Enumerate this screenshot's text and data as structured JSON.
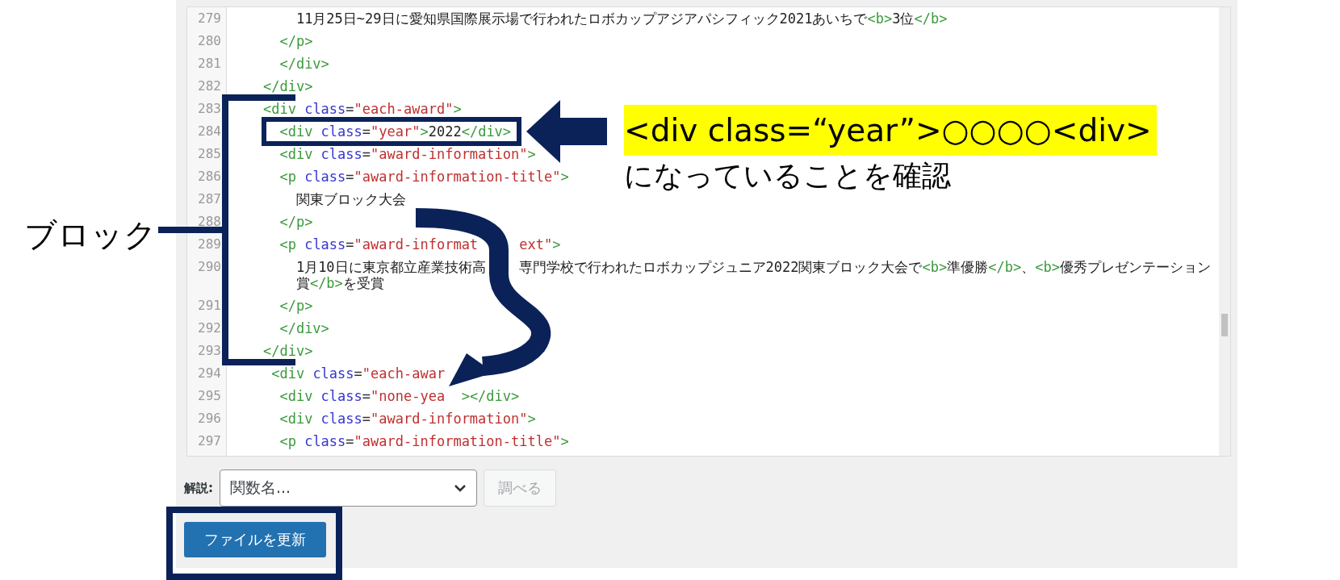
{
  "editor": {
    "lines": [
      {
        "number": "279",
        "tokens": [
          {
            "kind": "text",
            "text": "        11月25日~29日に愛知県国際展示場で行われたロボカップアジアパシフィック2021あいちで"
          },
          {
            "kind": "tag",
            "text": "<b>"
          },
          {
            "kind": "text",
            "text": "3位"
          },
          {
            "kind": "tag",
            "text": "</b>"
          }
        ]
      },
      {
        "number": "280",
        "tokens": [
          {
            "kind": "tag",
            "text": "      </p>"
          }
        ]
      },
      {
        "number": "281",
        "tokens": [
          {
            "kind": "tag",
            "text": "      </div>"
          }
        ]
      },
      {
        "number": "282",
        "tokens": [
          {
            "kind": "tag",
            "text": "    </div>"
          }
        ]
      },
      {
        "number": "283",
        "tokens": [
          {
            "kind": "tag",
            "text": "    <div"
          },
          {
            "kind": "attr",
            "text": " class"
          },
          {
            "kind": "op",
            "text": "="
          },
          {
            "kind": "str",
            "text": "\"each-award\""
          },
          {
            "kind": "tag",
            "text": ">"
          }
        ]
      },
      {
        "number": "284",
        "tokens": [
          {
            "kind": "tag",
            "text": "      <div"
          },
          {
            "kind": "attr",
            "text": " class"
          },
          {
            "kind": "op",
            "text": "="
          },
          {
            "kind": "str",
            "text": "\"year\""
          },
          {
            "kind": "tag",
            "text": ">"
          },
          {
            "kind": "text",
            "text": "2022"
          },
          {
            "kind": "tag",
            "text": "</div>"
          }
        ]
      },
      {
        "number": "285",
        "tokens": [
          {
            "kind": "tag",
            "text": "      <div"
          },
          {
            "kind": "attr",
            "text": " class"
          },
          {
            "kind": "op",
            "text": "="
          },
          {
            "kind": "str",
            "text": "\"award-information\""
          },
          {
            "kind": "tag",
            "text": ">"
          }
        ]
      },
      {
        "number": "286",
        "tokens": [
          {
            "kind": "tag",
            "text": "      <p"
          },
          {
            "kind": "attr",
            "text": " class"
          },
          {
            "kind": "op",
            "text": "="
          },
          {
            "kind": "str",
            "text": "\"award-information-title\""
          },
          {
            "kind": "tag",
            "text": ">"
          }
        ]
      },
      {
        "number": "287",
        "tokens": [
          {
            "kind": "text",
            "text": "        関東ブロック大会"
          }
        ]
      },
      {
        "number": "288",
        "tokens": [
          {
            "kind": "tag",
            "text": "      </p>"
          }
        ]
      },
      {
        "number": "289",
        "tokens": [
          {
            "kind": "tag",
            "text": "      <p"
          },
          {
            "kind": "attr",
            "text": " class"
          },
          {
            "kind": "op",
            "text": "="
          },
          {
            "kind": "str",
            "text": "\"award-informat     ext\""
          },
          {
            "kind": "tag",
            "text": ">"
          }
        ]
      },
      {
        "number": "290",
        "tokens": [
          {
            "kind": "text",
            "text": "        1月10日に東京都立産業技術高    専門学校で行われたロボカップジュニア2022関東ブロック大会で"
          },
          {
            "kind": "tag",
            "text": "<b>"
          },
          {
            "kind": "text",
            "text": "準優勝"
          },
          {
            "kind": "tag",
            "text": "</b>"
          },
          {
            "kind": "text",
            "text": "、"
          },
          {
            "kind": "tag",
            "text": "<b>"
          },
          {
            "kind": "text",
            "text": "優秀プレゼンテーション賞"
          },
          {
            "kind": "tag",
            "text": "</b>"
          },
          {
            "kind": "text",
            "text": "を受賞"
          }
        ]
      },
      {
        "number": "291",
        "tokens": [
          {
            "kind": "tag",
            "text": "      </p>"
          }
        ]
      },
      {
        "number": "292",
        "tokens": [
          {
            "kind": "tag",
            "text": "      </div>"
          }
        ]
      },
      {
        "number": "293",
        "tokens": [
          {
            "kind": "tag",
            "text": "    </div>"
          }
        ]
      },
      {
        "number": "294",
        "tokens": [
          {
            "kind": "tag",
            "text": "     <div"
          },
          {
            "kind": "attr",
            "text": " class"
          },
          {
            "kind": "op",
            "text": "="
          },
          {
            "kind": "str",
            "text": "\"each-awar"
          }
        ]
      },
      {
        "number": "295",
        "tokens": [
          {
            "kind": "tag",
            "text": "      <div"
          },
          {
            "kind": "attr",
            "text": " class"
          },
          {
            "kind": "op",
            "text": "="
          },
          {
            "kind": "str",
            "text": "\"none-yea"
          },
          {
            "kind": "tag",
            "text": "  ></div>"
          }
        ]
      },
      {
        "number": "296",
        "tokens": [
          {
            "kind": "tag",
            "text": "      <div"
          },
          {
            "kind": "attr",
            "text": " class"
          },
          {
            "kind": "op",
            "text": "="
          },
          {
            "kind": "str",
            "text": "\"award-information\""
          },
          {
            "kind": "tag",
            "text": ">"
          }
        ]
      },
      {
        "number": "297",
        "tokens": [
          {
            "kind": "tag",
            "text": "      <p"
          },
          {
            "kind": "attr",
            "text": " class"
          },
          {
            "kind": "op",
            "text": "="
          },
          {
            "kind": "str",
            "text": "\"award-information-title\""
          },
          {
            "kind": "tag",
            "text": ">"
          }
        ]
      }
    ]
  },
  "lookup": {
    "label": "解説:",
    "placeholder": "関数名...",
    "button": {
      "label": "調べる",
      "disabled": true
    }
  },
  "update_button": "ファイルを更新",
  "annotations": {
    "block_label": "ブロック",
    "callout_code": "<div class=“year”>○○○○<div>",
    "callout_note": "になっていることを確認"
  }
}
